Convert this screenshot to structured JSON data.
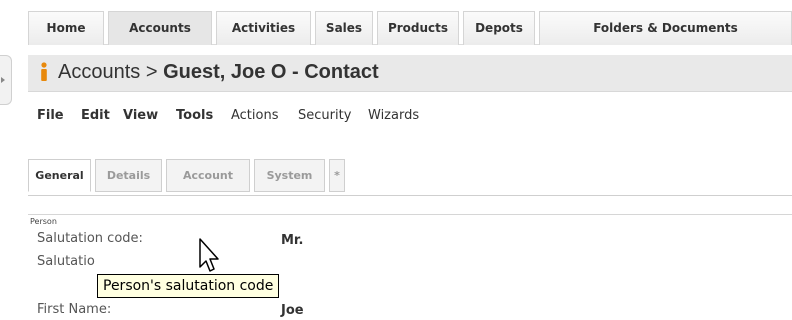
{
  "topnav": {
    "tabs": [
      {
        "label": "Home"
      },
      {
        "label": "Accounts"
      },
      {
        "label": "Activities"
      },
      {
        "label": "Sales"
      },
      {
        "label": "Products"
      },
      {
        "label": "Depots"
      },
      {
        "label": "Folders & Documents"
      }
    ],
    "active": "Accounts"
  },
  "titlebar": {
    "icon": "person-icon",
    "prefix": "Accounts > ",
    "record": "Guest, Joe O - Contact"
  },
  "menubar": {
    "items": [
      "File",
      "Edit",
      "View",
      "Tools",
      "Actions",
      "Security",
      "Wizards"
    ]
  },
  "subtabs": {
    "tabs": [
      {
        "label": "General"
      },
      {
        "label": "Details"
      },
      {
        "label": "Account"
      },
      {
        "label": "System"
      },
      {
        "label": "*"
      }
    ],
    "active": "General"
  },
  "form": {
    "section": "Person",
    "fields": [
      {
        "label": "Salutation code:",
        "value": "Mr."
      },
      {
        "label": "Salutatio",
        "value": ""
      },
      {
        "label": "First Name:",
        "value": "Joe"
      }
    ]
  },
  "tooltip": {
    "text": "Person's salutation code"
  },
  "colors": {
    "tooltip_bg": "#ffffe1",
    "icon_orange": "#e8890c"
  }
}
